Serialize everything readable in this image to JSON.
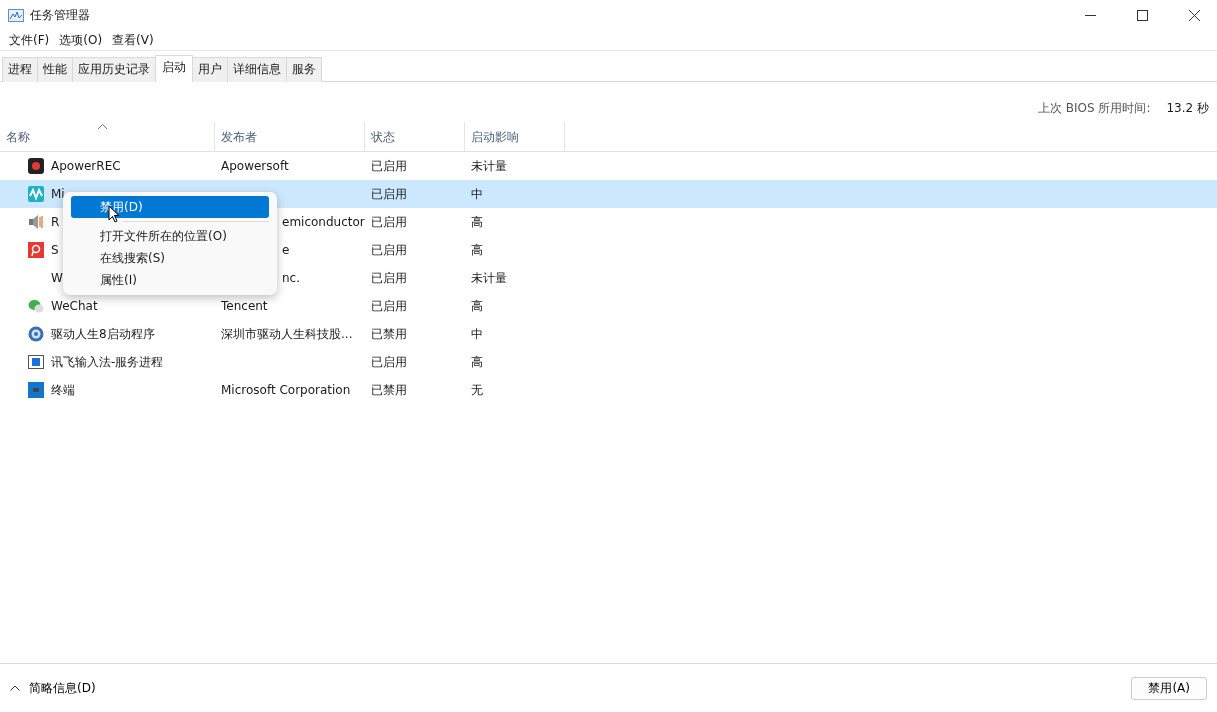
{
  "window": {
    "title": "任务管理器"
  },
  "menu_bar": [
    "文件(F)",
    "选项(O)",
    "查看(V)"
  ],
  "tabs": [
    {
      "label": "进程",
      "selected": false
    },
    {
      "label": "性能",
      "selected": false
    },
    {
      "label": "应用历史记录",
      "selected": false
    },
    {
      "label": "启动",
      "selected": true
    },
    {
      "label": "用户",
      "selected": false
    },
    {
      "label": "详细信息",
      "selected": false
    },
    {
      "label": "服务",
      "selected": false
    }
  ],
  "bios_time": {
    "label": "上次 BIOS 所用时间:",
    "value": "13.2 秒"
  },
  "table": {
    "columns": [
      {
        "label": "名称",
        "sorted": true
      },
      {
        "label": "发布者",
        "sorted": false
      },
      {
        "label": "状态",
        "sorted": false
      },
      {
        "label": "启动影响",
        "sorted": false
      }
    ],
    "rows": [
      {
        "kind": "record",
        "name": "ApowerREC",
        "publisher": "Apowersoft",
        "status": "已启用",
        "impact": "未计量",
        "selected": false
      },
      {
        "kind": "wave",
        "name": "Mi",
        "status": "已启用",
        "impact": "中",
        "selected": true
      },
      {
        "kind": "speaker",
        "name": "R",
        "publisher_tail": "emiconductor",
        "status": "已启用",
        "impact": "高",
        "selected": false
      },
      {
        "kind": "pin",
        "name": "S",
        "publisher_tail": "e",
        "status": "已启用",
        "impact": "高",
        "selected": false
      },
      {
        "kind": "none",
        "name": "W",
        "publisher_tail": "nc.",
        "status": "已启用",
        "impact": "未计量",
        "selected": false
      },
      {
        "kind": "chat",
        "name": "WeChat",
        "publisher": "Tencent",
        "status": "已启用",
        "impact": "高",
        "selected": false
      },
      {
        "kind": "gear",
        "name": "驱动人生8启动程序",
        "publisher": "深圳市驱动人生科技股...",
        "status": "已禁用",
        "impact": "中",
        "selected": false
      },
      {
        "kind": "window",
        "name": "讯飞输入法-服务进程",
        "status": "已启用",
        "impact": "高",
        "selected": false
      },
      {
        "kind": "terminal",
        "name": "终端",
        "publisher": "Microsoft Corporation",
        "status": "已禁用",
        "impact": "无",
        "selected": false
      }
    ]
  },
  "context_menu": {
    "items": [
      {
        "label": "禁用(D)",
        "selected": true,
        "separator_after": true
      },
      {
        "label": "打开文件所在的位置(O)",
        "selected": false,
        "separator_after": false
      },
      {
        "label": "在线搜索(S)",
        "selected": false,
        "separator_after": false
      },
      {
        "label": "属性(I)",
        "selected": false,
        "separator_after": false
      }
    ]
  },
  "footer": {
    "details_toggle": "简略信息(D)",
    "button": "禁用(A)"
  }
}
